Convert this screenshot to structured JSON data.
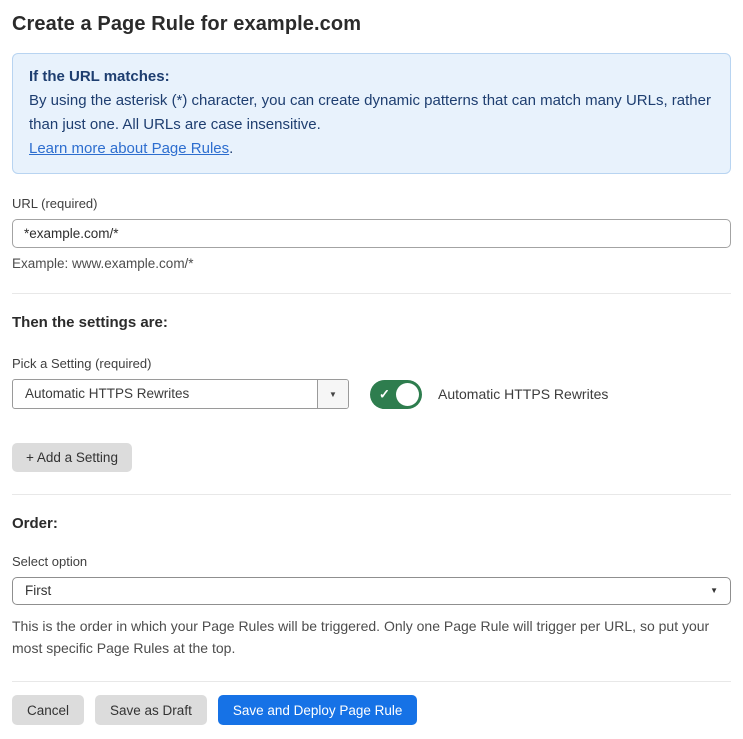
{
  "page": {
    "title": "Create a Page Rule for example.com"
  },
  "info_box": {
    "heading": "If the URL matches:",
    "body": "By using the asterisk (*) character, you can create dynamic patterns that can match many URLs, rather than just one. All URLs are case insensitive.",
    "link_label": "Learn more about Page Rules",
    "link_suffix": "."
  },
  "url_field": {
    "label": "URL (required)",
    "value": "*example.com/*",
    "helper": "Example: www.example.com/*"
  },
  "settings_section": {
    "heading": "Then the settings are:",
    "picker_label": "Pick a Setting (required)",
    "selected_setting": "Automatic HTTPS Rewrites",
    "picker_arrow": "▼",
    "toggle": {
      "state": "on",
      "check_glyph": "✓",
      "label": "Automatic HTTPS Rewrites"
    },
    "add_button_label": "+ Add a Setting"
  },
  "order_section": {
    "heading": "Order:",
    "select_label": "Select option",
    "selected_option": "First",
    "select_arrow": "▼",
    "helper": "This is the order in which your Page Rules will be triggered. Only one Page Rule will trigger per URL, so put your most specific Page Rules at the top."
  },
  "footer": {
    "cancel_label": "Cancel",
    "save_draft_label": "Save as Draft",
    "deploy_label": "Save and Deploy Page Rule"
  },
  "colors": {
    "accent_blue": "#1672e6",
    "info_bg": "#e8f2fc",
    "info_border": "#b8d4f1",
    "info_text": "#1e3e70",
    "link_blue": "#2d6ecf",
    "toggle_green": "#2e7d4e"
  }
}
